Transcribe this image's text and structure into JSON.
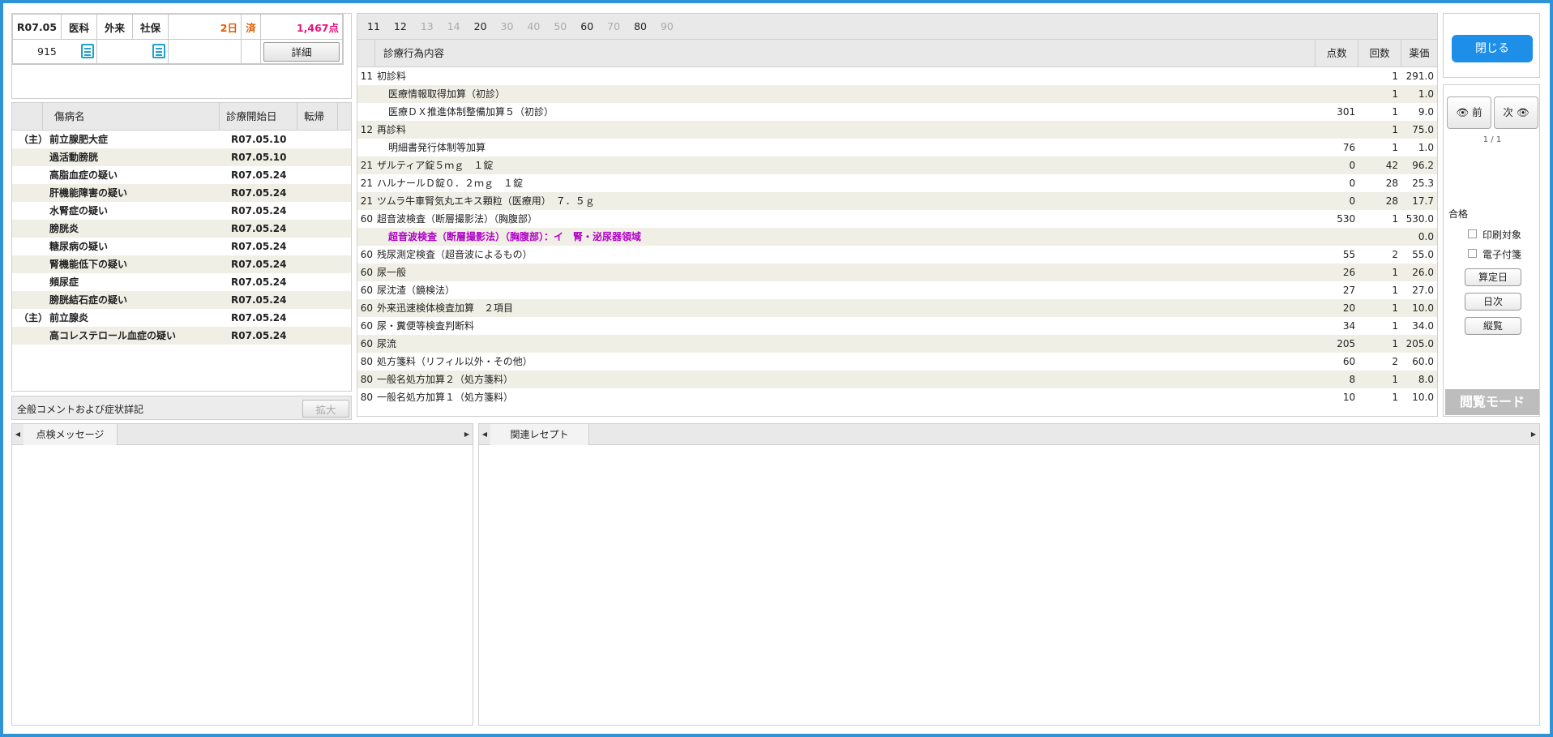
{
  "header": {
    "date": "R07.05",
    "dept": "医科",
    "visit_type": "外来",
    "insurance": "社保",
    "days": "2日",
    "status": "済",
    "points": "1,467点",
    "patient_no": "915",
    "detail_button": "詳細"
  },
  "diagnosis": {
    "columns": [
      "傷病名",
      "診療開始日",
      "転帰"
    ],
    "rows": [
      {
        "main": "（主）",
        "name": "前立腺肥大症",
        "date": "R07.05.10"
      },
      {
        "main": "",
        "name": "過活動膀胱",
        "date": "R07.05.10"
      },
      {
        "main": "",
        "name": "高脂血症の疑い",
        "date": "R07.05.24"
      },
      {
        "main": "",
        "name": "肝機能障害の疑い",
        "date": "R07.05.24"
      },
      {
        "main": "",
        "name": "水腎症の疑い",
        "date": "R07.05.24"
      },
      {
        "main": "",
        "name": "膀胱炎",
        "date": "R07.05.24"
      },
      {
        "main": "",
        "name": "糖尿病の疑い",
        "date": "R07.05.24"
      },
      {
        "main": "",
        "name": "腎機能低下の疑い",
        "date": "R07.05.24"
      },
      {
        "main": "",
        "name": "頻尿症",
        "date": "R07.05.24"
      },
      {
        "main": "",
        "name": "膀胱結石症の疑い",
        "date": "R07.05.24"
      },
      {
        "main": "（主）",
        "name": "前立腺炎",
        "date": "R07.05.24"
      },
      {
        "main": "",
        "name": "高コレステロール血症の疑い",
        "date": "R07.05.24"
      }
    ]
  },
  "comment": {
    "label": "全般コメントおよび症状詳記",
    "expand_button": "拡大"
  },
  "procedures": {
    "tabs": [
      {
        "label": "11",
        "active": true
      },
      {
        "label": "12",
        "active": true
      },
      {
        "label": "13",
        "active": false
      },
      {
        "label": "14",
        "active": false
      },
      {
        "label": "20",
        "active": true
      },
      {
        "label": "30",
        "active": false
      },
      {
        "label": "40",
        "active": false
      },
      {
        "label": "50",
        "active": false
      },
      {
        "label": "60",
        "active": true
      },
      {
        "label": "70",
        "active": false
      },
      {
        "label": "80",
        "active": true
      },
      {
        "label": "90",
        "active": false
      }
    ],
    "columns": {
      "content": "診療行為内容",
      "points": "点数",
      "count": "回数",
      "amount": "薬価"
    },
    "rows": [
      {
        "code": "11",
        "name": "初診料",
        "points": "",
        "count": "1",
        "amount": "291.0"
      },
      {
        "code": "",
        "name": "医療情報取得加算（初診）",
        "points": "",
        "count": "1",
        "amount": "1.0"
      },
      {
        "code": "",
        "name": "医療ＤＸ推進体制整備加算５（初診）",
        "points": "301",
        "count": "1",
        "amount": "9.0"
      },
      {
        "code": "12",
        "name": "再診料",
        "points": "",
        "count": "1",
        "amount": "75.0"
      },
      {
        "code": "",
        "name": "明細書発行体制等加算",
        "points": "76",
        "count": "1",
        "amount": "1.0"
      },
      {
        "code": "21",
        "name": "ザルティア錠５ｍｇ　１錠",
        "points": "0",
        "count": "42",
        "amount": "96.2"
      },
      {
        "code": "21",
        "name": "ハルナールＤ錠０．２ｍｇ　１錠",
        "points": "0",
        "count": "28",
        "amount": "25.3"
      },
      {
        "code": "21",
        "name": "ツムラ牛車腎気丸エキス顆粒（医療用）　７．５ｇ",
        "points": "0",
        "count": "28",
        "amount": "17.7"
      },
      {
        "code": "60",
        "name": "超音波検査（断層撮影法）（胸腹部）",
        "points": "530",
        "count": "1",
        "amount": "530.0"
      },
      {
        "code": "",
        "name": "超音波検査（断層撮影法）（胸腹部）：イ　腎・泌尿器領域",
        "points": "",
        "count": "",
        "amount": "0.0",
        "highlight": true
      },
      {
        "code": "60",
        "name": "残尿測定検査（超音波によるもの）",
        "points": "55",
        "count": "2",
        "amount": "55.0"
      },
      {
        "code": "60",
        "name": "尿一般",
        "points": "26",
        "count": "1",
        "amount": "26.0"
      },
      {
        "code": "60",
        "name": "尿沈渣（鏡検法）",
        "points": "27",
        "count": "1",
        "amount": "27.0"
      },
      {
        "code": "60",
        "name": "外来迅速検体検査加算　２項目",
        "points": "20",
        "count": "1",
        "amount": "10.0"
      },
      {
        "code": "60",
        "name": "尿・糞便等検査判断料",
        "points": "34",
        "count": "1",
        "amount": "34.0"
      },
      {
        "code": "60",
        "name": "尿流",
        "points": "205",
        "count": "1",
        "amount": "205.0"
      },
      {
        "code": "80",
        "name": "処方箋料（リフィル以外・その他）",
        "points": "60",
        "count": "2",
        "amount": "60.0"
      },
      {
        "code": "80",
        "name": "一般名処方加算２（処方箋料）",
        "points": "8",
        "count": "1",
        "amount": "8.0"
      },
      {
        "code": "80",
        "name": "一般名処方加算１（処方箋料）",
        "points": "10",
        "count": "1",
        "amount": "10.0"
      }
    ]
  },
  "sidebar": {
    "close_button": "閉じる",
    "prev_button": "前",
    "next_button": "次",
    "page_indicator": "1 / 1",
    "status": "合格",
    "print_target": "印刷対象",
    "e_signature": "電子付箋",
    "calc_day_button": "算定日",
    "daily_button": "日次",
    "vertical_button": "縦覧",
    "view_mode": "閲覧モード"
  },
  "bottom": {
    "check_tab": "点検メッセージ",
    "related_tab": "関連レセプト"
  },
  "colors": {
    "accent": "#1e8fe8",
    "frame": "#2f93d6",
    "highlight_text": "#b000c8",
    "points_pink": "#e8127c",
    "days_orange": "#e25a00"
  }
}
